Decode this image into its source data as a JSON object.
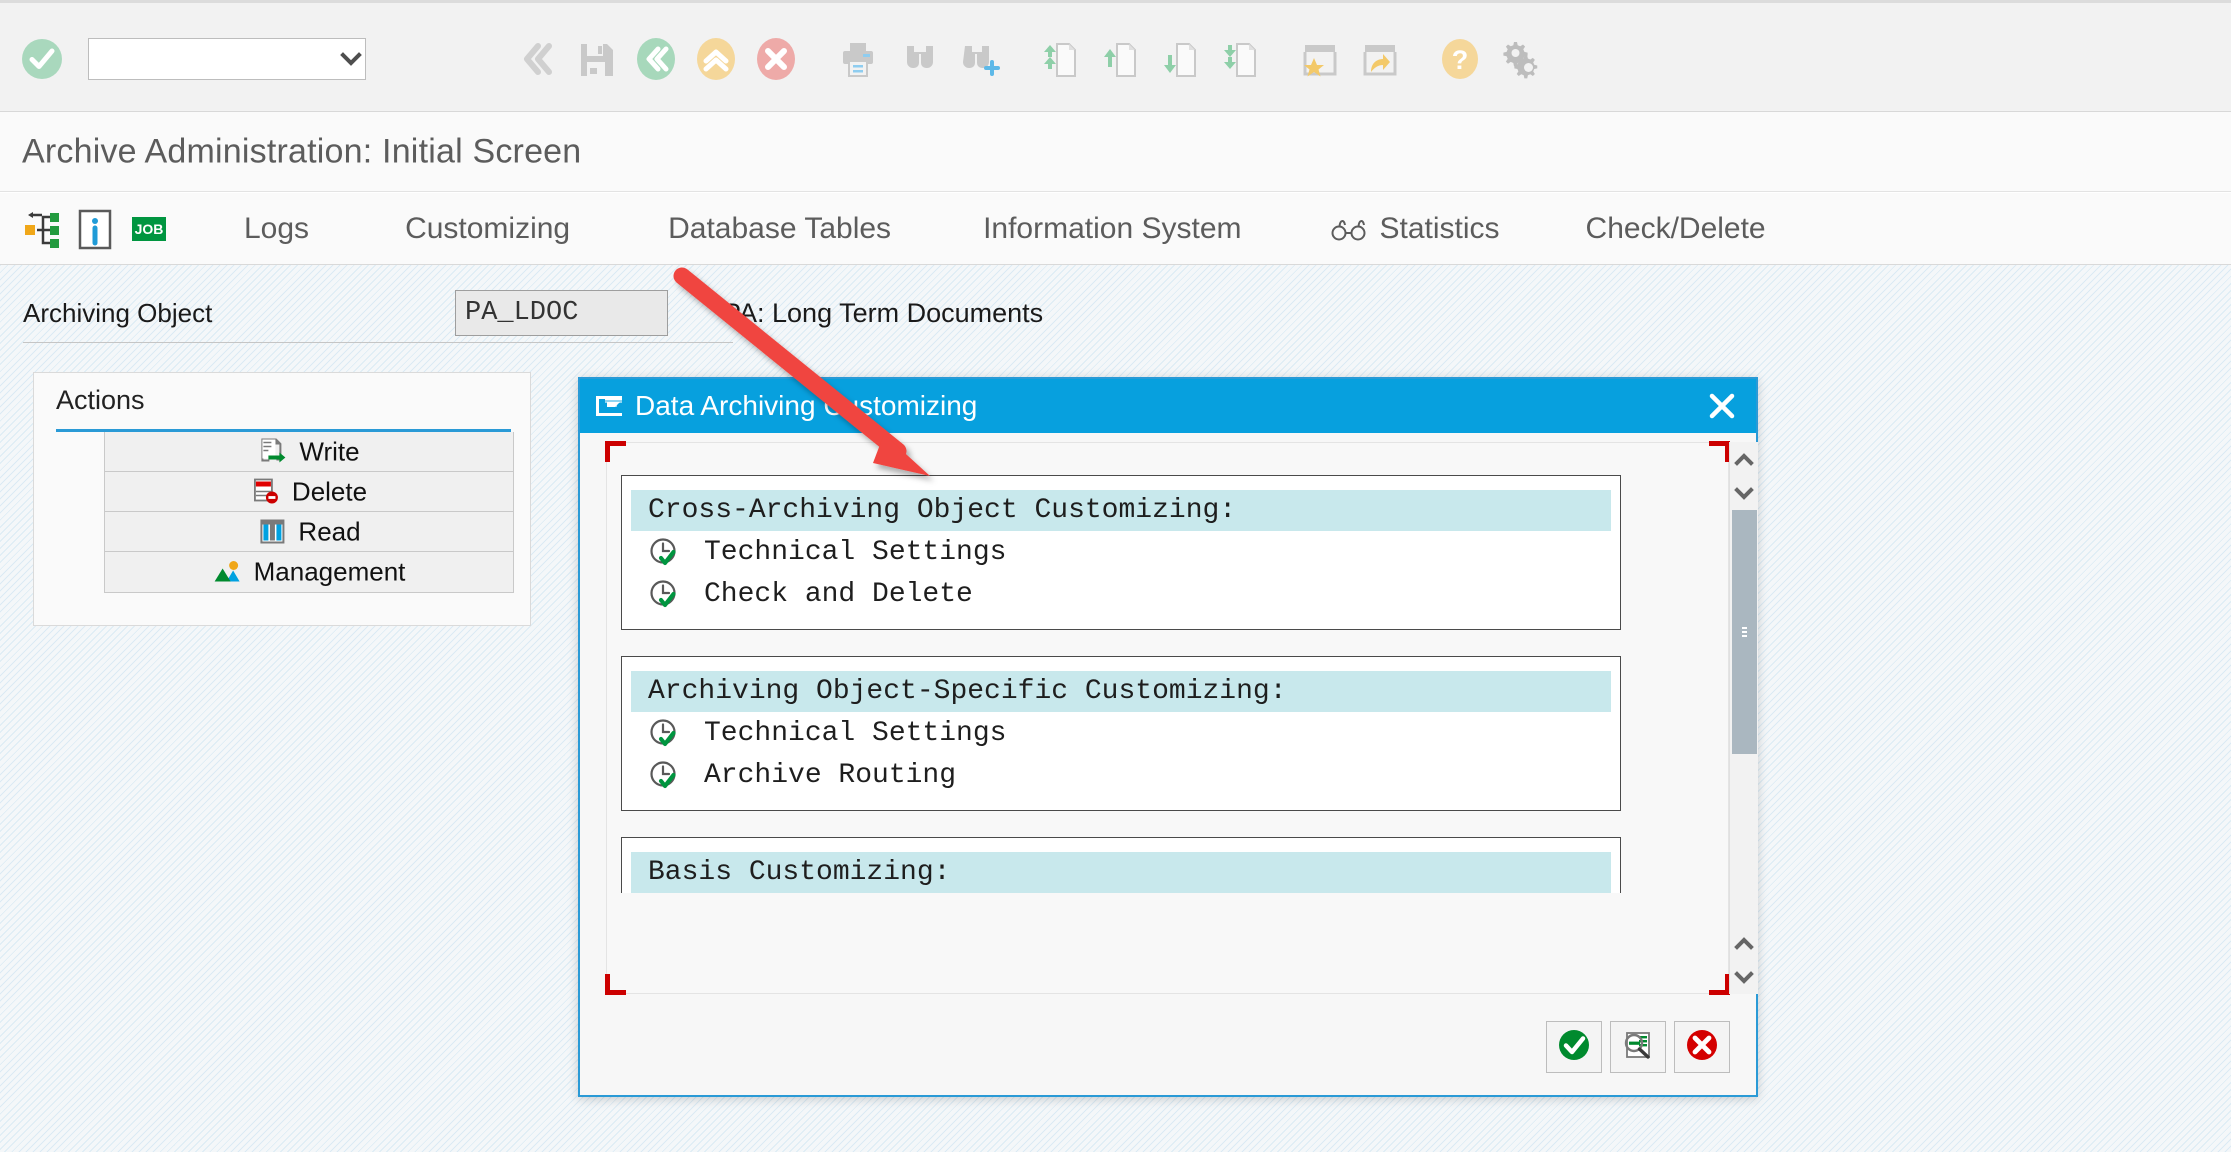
{
  "window": {
    "screen_title": "Archive Administration: Initial Screen"
  },
  "toolbar": {
    "command_field": {
      "value": "",
      "placeholder": ""
    },
    "icons": [
      {
        "name": "confirm-enter-icon",
        "label": "Enter"
      },
      {
        "name": "back-double-chevron-icon",
        "label": "Back"
      },
      {
        "name": "save-icon",
        "label": "Save"
      },
      {
        "name": "back-icon",
        "label": "Back"
      },
      {
        "name": "exit-icon",
        "label": "Exit"
      },
      {
        "name": "cancel-icon",
        "label": "Cancel"
      },
      {
        "name": "print-icon",
        "label": "Print"
      },
      {
        "name": "find-icon",
        "label": "Find"
      },
      {
        "name": "find-next-icon",
        "label": "Find Next"
      },
      {
        "name": "first-page-icon",
        "label": "First Page"
      },
      {
        "name": "previous-page-icon",
        "label": "Previous Page"
      },
      {
        "name": "next-page-icon",
        "label": "Next Page"
      },
      {
        "name": "last-page-icon",
        "label": "Last Page"
      },
      {
        "name": "create-favorite-icon",
        "label": "Create Shortcut"
      },
      {
        "name": "new-window-icon",
        "label": "Create New Session"
      },
      {
        "name": "help-icon",
        "label": "Help"
      },
      {
        "name": "customize-local-layout-icon",
        "label": "Customize Local Layout"
      }
    ]
  },
  "menubar": {
    "icon_buttons": [
      {
        "name": "object-hierarchy-icon",
        "label": "Archiving Object Hierarchy"
      },
      {
        "name": "info-icon",
        "label": "Information"
      },
      {
        "name": "job-icon",
        "label": "JOB"
      }
    ],
    "items": [
      {
        "name": "logs",
        "label": "Logs",
        "icon": null
      },
      {
        "name": "customizing",
        "label": "Customizing",
        "icon": null
      },
      {
        "name": "database-tables",
        "label": "Database Tables",
        "icon": null
      },
      {
        "name": "information-system",
        "label": "Information System",
        "icon": null
      },
      {
        "name": "statistics",
        "label": "Statistics",
        "icon": "glasses-icon"
      },
      {
        "name": "check-delete",
        "label": "Check/Delete",
        "icon": null
      }
    ]
  },
  "form": {
    "archiving_object": {
      "label": "Archiving Object",
      "value": "PA_LDOC",
      "description": "PA: Long Term Documents"
    }
  },
  "actions_panel": {
    "title": "Actions",
    "accent_color": "#2a9ad6",
    "rows": [
      {
        "name": "write",
        "label": "Write",
        "icon": "write-document-icon"
      },
      {
        "name": "delete",
        "label": "Delete",
        "icon": "delete-table-icon"
      },
      {
        "name": "read",
        "label": "Read",
        "icon": "read-columns-icon"
      },
      {
        "name": "management",
        "label": "Management",
        "icon": "management-mountain-icon"
      }
    ]
  },
  "dialog": {
    "title": "Data Archiving Customizing",
    "title_icon": "dialog-window-icon",
    "titlebar_color": "#07a0de",
    "close_label": "Close",
    "groups": [
      {
        "name": "cross-archiving-object-customizing",
        "header": "Cross-Archiving Object Customizing:",
        "items": [
          {
            "name": "technical-settings",
            "label": "Technical Settings",
            "icon": "clock-check-icon"
          },
          {
            "name": "check-and-delete",
            "label": "Check and Delete",
            "icon": "clock-check-icon"
          }
        ]
      },
      {
        "name": "archiving-object-specific-customizing",
        "header": "Archiving Object-Specific Customizing:",
        "items": [
          {
            "name": "technical-settings",
            "label": "Technical Settings",
            "icon": "clock-check-icon"
          },
          {
            "name": "archive-routing",
            "label": "Archive Routing",
            "icon": "clock-check-icon"
          }
        ]
      },
      {
        "name": "basis-customizing",
        "header": "Basis Customizing:",
        "items": []
      }
    ],
    "scrollbar": {
      "name": "vertical-scrollbar",
      "up_label": "Scroll Up",
      "down_label": "Scroll Down"
    },
    "footer_buttons": [
      {
        "name": "continue-button",
        "icon": "green-check-icon",
        "label": "Continue"
      },
      {
        "name": "display-button",
        "icon": "magnifier-list-icon",
        "label": "Display"
      },
      {
        "name": "cancel-button",
        "icon": "red-cancel-icon",
        "label": "Cancel"
      }
    ]
  },
  "annotation": {
    "arrow_color": "#f0453f",
    "name": "red-pointer-arrow"
  }
}
